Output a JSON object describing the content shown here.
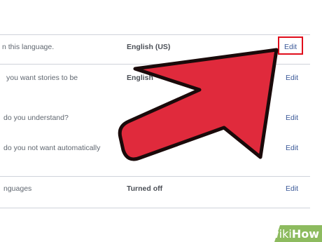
{
  "rows": [
    {
      "label": "n this language.",
      "value": "English (US)",
      "action": "Edit"
    },
    {
      "label": "you want stories to be",
      "value": "English",
      "action": "Edit"
    },
    {
      "label": "do you understand?",
      "value": "",
      "action": "Edit"
    },
    {
      "label": "do you not want automatically",
      "value": "",
      "action": "Edit"
    },
    {
      "label": "nguages",
      "value": "Turned off",
      "action": "Edit"
    }
  ],
  "watermark": {
    "wiki": "wiki",
    "how": "How"
  },
  "colors": {
    "link": "#3b5998",
    "highlight_box": "#e10e1c",
    "arrow_fill": "#e02a3c",
    "arrow_stroke": "#1a0a0a",
    "watermark_bg": "#8dbb5f"
  },
  "annotations": {
    "pointer": "red-arrow-icon"
  }
}
